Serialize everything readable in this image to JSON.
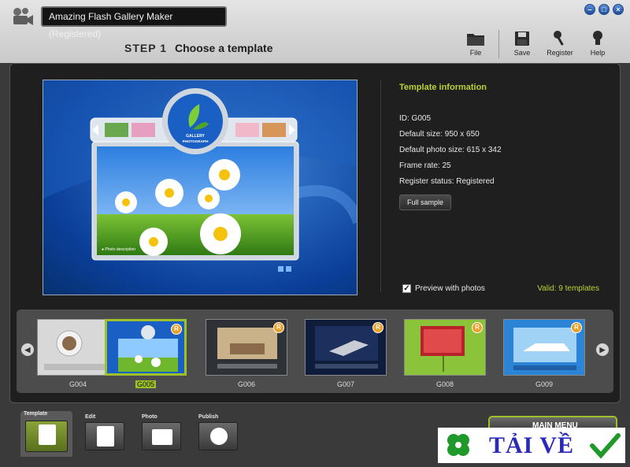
{
  "window": {
    "title": "Amazing Flash Gallery Maker (Registered)",
    "controls": [
      "minimize",
      "restore",
      "close"
    ]
  },
  "step": {
    "number": "STEP 1",
    "title": "Choose a template"
  },
  "toolbar": [
    {
      "label": "File",
      "icon": "folder-icon"
    },
    {
      "label": "Save",
      "icon": "floppy-icon"
    },
    {
      "label": "Register",
      "icon": "key-icon"
    },
    {
      "label": "Help",
      "icon": "lightbulb-icon"
    }
  ],
  "preview": {
    "caption": "Photo description",
    "logo_text": "GALLERY PHOTOGRAPH"
  },
  "template_info": {
    "heading": "Template information",
    "id": "ID: G005",
    "default_size": "Default size: 950 x 650",
    "photo_size": "Default photo size: 615 x 342",
    "frame_rate": "Frame rate: 25",
    "register_status": "Register status: Registered",
    "full_sample_label": "Full sample"
  },
  "preview_with_photos": {
    "label": "Preview with photos",
    "checked": true
  },
  "valid_text": "Valid: 9 templates",
  "thumbnails": [
    {
      "id": "G004",
      "selected": false,
      "colors": [
        "#cfcfcf",
        "#8a6a4a"
      ]
    },
    {
      "id": "G005",
      "selected": true,
      "colors": [
        "#1a5fc4",
        "#6fb82e"
      ]
    },
    {
      "id": "G006",
      "selected": false,
      "colors": [
        "#2e3136",
        "#c9b28a"
      ]
    },
    {
      "id": "G007",
      "selected": false,
      "colors": [
        "#0f1c3a",
        "#c9ccd4"
      ]
    },
    {
      "id": "G008",
      "selected": false,
      "colors": [
        "#8bc43a",
        "#b8222a"
      ]
    },
    {
      "id": "G009",
      "selected": false,
      "colors": [
        "#2b84d6",
        "#9fd2f5"
      ]
    }
  ],
  "nav_tabs": [
    {
      "label": "Template",
      "active": true
    },
    {
      "label": "Edit",
      "active": false
    },
    {
      "label": "Photo",
      "active": false
    },
    {
      "label": "Publish",
      "active": false
    }
  ],
  "main_menu": "MAIN MENU",
  "watermark": "TẢI VỀ",
  "accent_color": "#9ec12a"
}
